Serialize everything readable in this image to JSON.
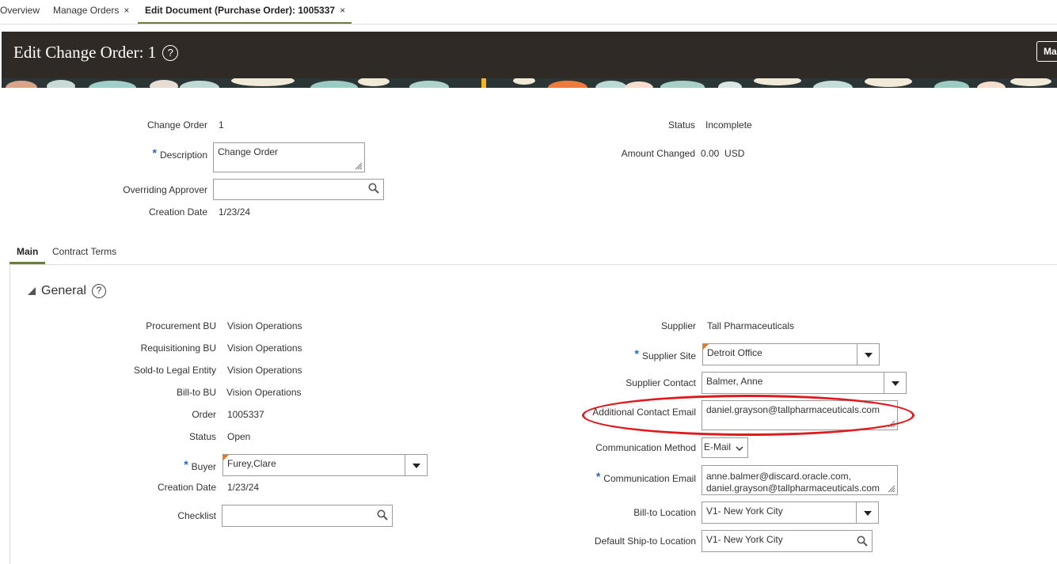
{
  "top_tabs": {
    "overview": "Overview",
    "manage_orders": "Manage Orders",
    "edit_document": "Edit Document (Purchase Order): 1005337",
    "close_glyph": "×"
  },
  "header": {
    "title": "Edit Change Order: 1",
    "help_glyph": "?",
    "manage_button": "Ma"
  },
  "order_header": {
    "change_order_label": "Change Order",
    "change_order_value": "1",
    "description_label": "Description",
    "description_value": "Change Order",
    "overriding_approver_label": "Overriding Approver",
    "overriding_approver_value": "",
    "creation_date_label": "Creation Date",
    "creation_date_value": "1/23/24",
    "status_label": "Status",
    "status_value": "Incomplete",
    "amount_changed_label": "Amount Changed",
    "amount_changed_value": "0.00",
    "amount_changed_currency": "USD"
  },
  "sub_tabs": {
    "main": "Main",
    "contract_terms": "Contract Terms"
  },
  "general": {
    "section_title": "General",
    "help_glyph": "?",
    "procurement_bu_label": "Procurement BU",
    "procurement_bu_value": "Vision Operations",
    "requisitioning_bu_label": "Requisitioning BU",
    "requisitioning_bu_value": "Vision Operations",
    "sold_to_label": "Sold-to Legal Entity",
    "sold_to_value": "Vision Operations",
    "bill_to_bu_label": "Bill-to BU",
    "bill_to_bu_value": "Vision Operations",
    "order_label": "Order",
    "order_value": "1005337",
    "status_label": "Status",
    "status_value": "Open",
    "buyer_label": "Buyer",
    "buyer_value": "Furey,Clare",
    "creation_date_label": "Creation Date",
    "creation_date_value": "1/23/24",
    "checklist_label": "Checklist",
    "checklist_value": "",
    "supplier_label": "Supplier",
    "supplier_value": "Tall Pharmaceuticals",
    "supplier_site_label": "Supplier Site",
    "supplier_site_value": "Detroit Office",
    "supplier_contact_label": "Supplier Contact",
    "supplier_contact_value": "Balmer, Anne",
    "additional_email_label": "Additional Contact Email",
    "additional_email_value": "daniel.grayson@tallpharmaceuticals.com",
    "comm_method_label": "Communication Method",
    "comm_method_value": "E-Mail",
    "comm_email_label": "Communication Email",
    "comm_email_line1": "anne.balmer@discard.oracle.com,",
    "comm_email_line2": "daniel.grayson@tallpharmaceuticals.com",
    "bill_to_location_label": "Bill-to Location",
    "bill_to_location_value": "V1- New York City",
    "ship_to_location_label": "Default Ship-to Location",
    "ship_to_location_value": "V1- New York City"
  },
  "colors": {
    "header_bg": "#2f2a26",
    "tab_accent": "#6c7e3f",
    "required_star": "#2469b3",
    "annotation_red": "#e0191c",
    "field_marker": "#e07b1f"
  }
}
